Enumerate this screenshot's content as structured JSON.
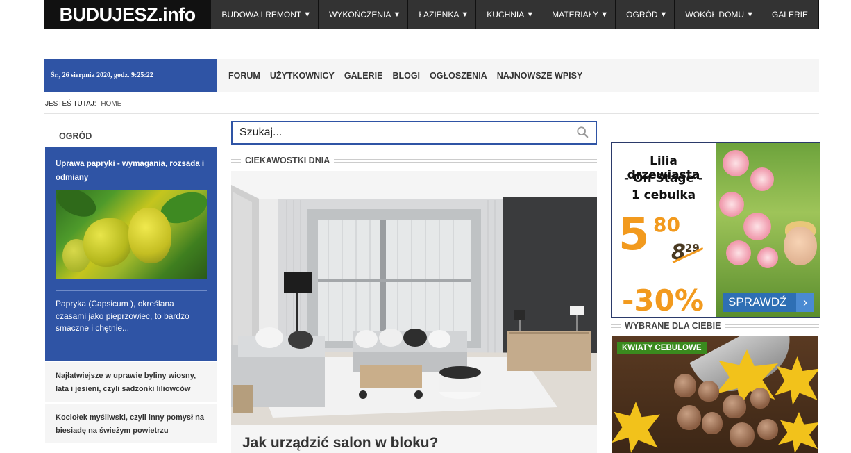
{
  "header": {
    "logo_text": "BUDUJESZ.info",
    "nav": [
      {
        "label": "BUDOWA I REMONT",
        "has_caret": true
      },
      {
        "label": "WYKOŃCZENIA",
        "has_caret": true
      },
      {
        "label": "ŁAZIENKA",
        "has_caret": true
      },
      {
        "label": "KUCHNIA",
        "has_caret": true
      },
      {
        "label": "MATERIAŁY",
        "has_caret": true
      },
      {
        "label": "OGRÓD",
        "has_caret": true
      },
      {
        "label": "WOKÓŁ DOMU",
        "has_caret": true
      },
      {
        "label": "GALERIE",
        "has_caret": false
      }
    ],
    "caret": "▼"
  },
  "datebar": {
    "text": "Śr., 26 sierpnia 2020, godz. 9:25:22"
  },
  "subnav": [
    "FORUM",
    "UŻYTKOWNICY",
    "GALERIE",
    "BLOGI",
    "OGŁOSZENIA",
    "NAJNOWSZE WPISY"
  ],
  "breadcrumb": {
    "prefix": "JESTEŚ TUTAJ:",
    "items": [
      "HOME"
    ]
  },
  "left_column": {
    "heading": "OGRÓD",
    "feature": {
      "title": "Uprawa papryki - wymagania, rozsada i odmiany",
      "description": "Papryka (Capsicum ), określana czasami jako pieprzowiec, to bardzo smaczne i chętnie..."
    },
    "list": [
      "Najłatwiejsze w uprawie byliny wiosny, lata i jesieni, czyli sadzonki liliowców",
      "Kociołek myśliwski, czyli inny pomysł na biesiadę na świeżym powietrzu"
    ]
  },
  "search": {
    "placeholder": "Szukaj...",
    "icon": "search-icon"
  },
  "center": {
    "heading": "CIEKAWOSTKI DNIA",
    "article_title": "Jak urządzić salon w bloku?"
  },
  "ad": {
    "line1": "Lilia drzewiasta",
    "line2": "- On Stage -",
    "line3": "1 cebulka",
    "price_main": "5",
    "price_cents": "80",
    "old_price_main": "8",
    "old_price_cents": "29",
    "discount": "-30%",
    "button": "SPRAWDŹ",
    "colors": {
      "price": "#f29a1e",
      "button": "#2e6fb4"
    }
  },
  "right_column": {
    "heading": "WYBRANE DLA CIEBIE",
    "badge": "KWIATY CEBULOWE"
  },
  "colors": {
    "brand_blue": "#2f54a5",
    "top_nav": "#333333",
    "badge_green": "#3a8a1e"
  }
}
